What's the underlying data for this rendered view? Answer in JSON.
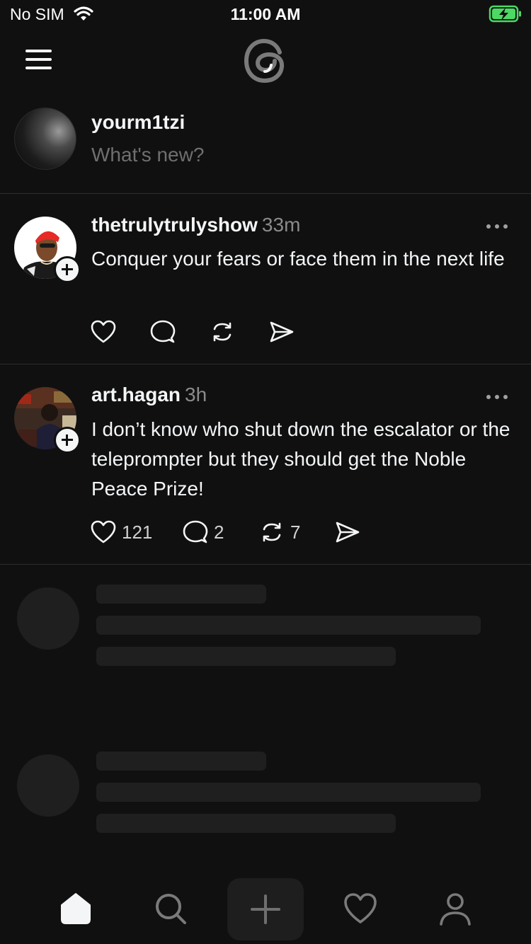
{
  "status_bar": {
    "carrier": "No SIM",
    "time": "11:00 AM"
  },
  "composer": {
    "username": "yourm1tzi",
    "placeholder": "What's new?"
  },
  "posts": [
    {
      "author": "thetrulytrulyshow",
      "time": "33m",
      "text": "Conquer your fears or face them in the next life",
      "likes": "",
      "replies": "",
      "reposts": ""
    },
    {
      "author": "art.hagan",
      "time": "3h",
      "text": "I don’t know who shut down the escalator or the teleprompter but they should get the Noble Peace Prize!",
      "likes": "121",
      "replies": "2",
      "reposts": "7"
    }
  ],
  "icons": {
    "menu": "menu-icon",
    "logo": "threads-logo-icon",
    "like": "heart-icon",
    "reply": "comment-icon",
    "repost": "repost-icon",
    "share": "send-icon",
    "more": "more-icon",
    "tabs": [
      "home-icon",
      "search-icon",
      "plus-icon",
      "heart-icon",
      "profile-icon"
    ]
  },
  "colors": {
    "background": "#101010",
    "text": "#f3f5f7",
    "muted": "#8a8a8a",
    "battery": "#4cd964",
    "skeleton": "#1f1f1f"
  }
}
